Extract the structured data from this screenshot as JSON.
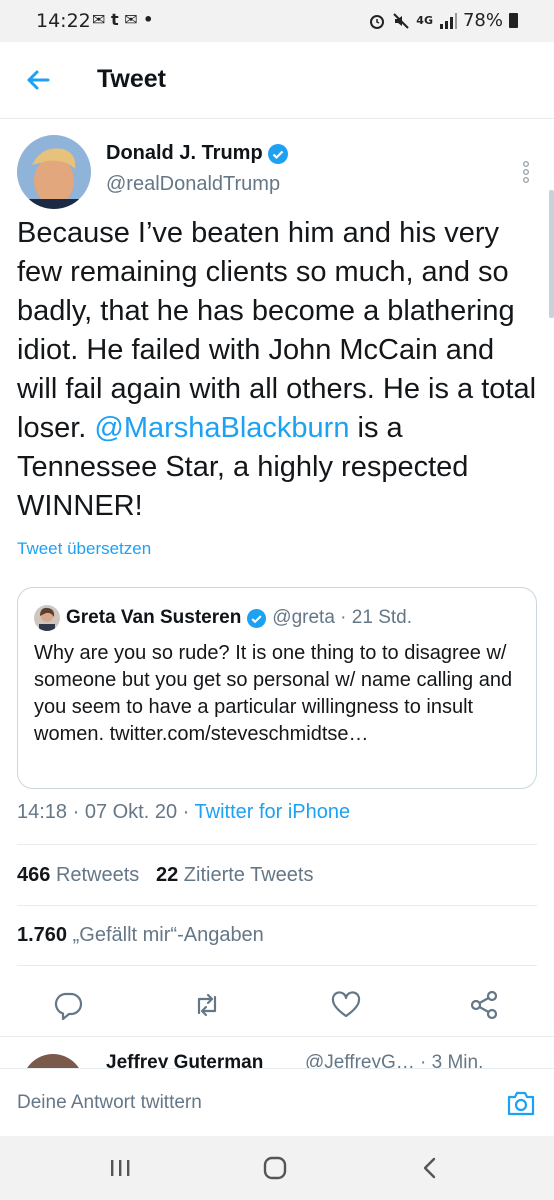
{
  "status_bar": {
    "time": "14:22",
    "notif_icons": "✉ t ✉ •",
    "net": "4G",
    "battery": "78%"
  },
  "app_bar": {
    "title": "Tweet"
  },
  "tweet": {
    "author_name": "Donald J. Trump",
    "author_handle": "@realDonaldTrump",
    "text_before": "Because I’ve beaten him and his very few remaining clients so much, and so badly, that he has become a blathering idiot. He failed with John McCain and will fail again with all others. He is a total loser. ",
    "mention": "@MarshaBlackburn",
    "text_after": " is a Tennessee Star, a highly respected WINNER!",
    "translate_label": "Tweet übersetzen",
    "timestamp": "14:18 · 07 Okt. 20 · ",
    "source": "Twitter for iPhone",
    "retweets_count": "466",
    "retweets_label": "Retweets",
    "quotes_count": "22",
    "quotes_label": "Zitierte Tweets",
    "likes_count": "1.760",
    "likes_label": "„Gefällt mir“-Angaben"
  },
  "quoted_tweet": {
    "name": "Greta Van Susteren",
    "handle_time": "@greta · 21 Std.",
    "text": "Why are you so rude? It is one thing to to disagree w/ someone but you get so personal w/ name calling and you seem to have a particular willingness to insult women. twitter.com/steveschmidtse…"
  },
  "next_reply": {
    "name": "Jeffrey Guterman",
    "meta": "@JeffreyG… · 3 Min."
  },
  "reply_box": {
    "placeholder": "Deine Antwort twittern"
  },
  "colors": {
    "accent": "#1da1f2",
    "secondary_text": "#657786",
    "divider": "#e6ecf0"
  },
  "icons": [
    "back-arrow-icon",
    "verified-icon",
    "more-vertical-icon",
    "reply-icon",
    "retweet-icon",
    "like-icon",
    "share-icon",
    "camera-icon",
    "recents-icon",
    "home-icon",
    "back-nav-icon"
  ]
}
